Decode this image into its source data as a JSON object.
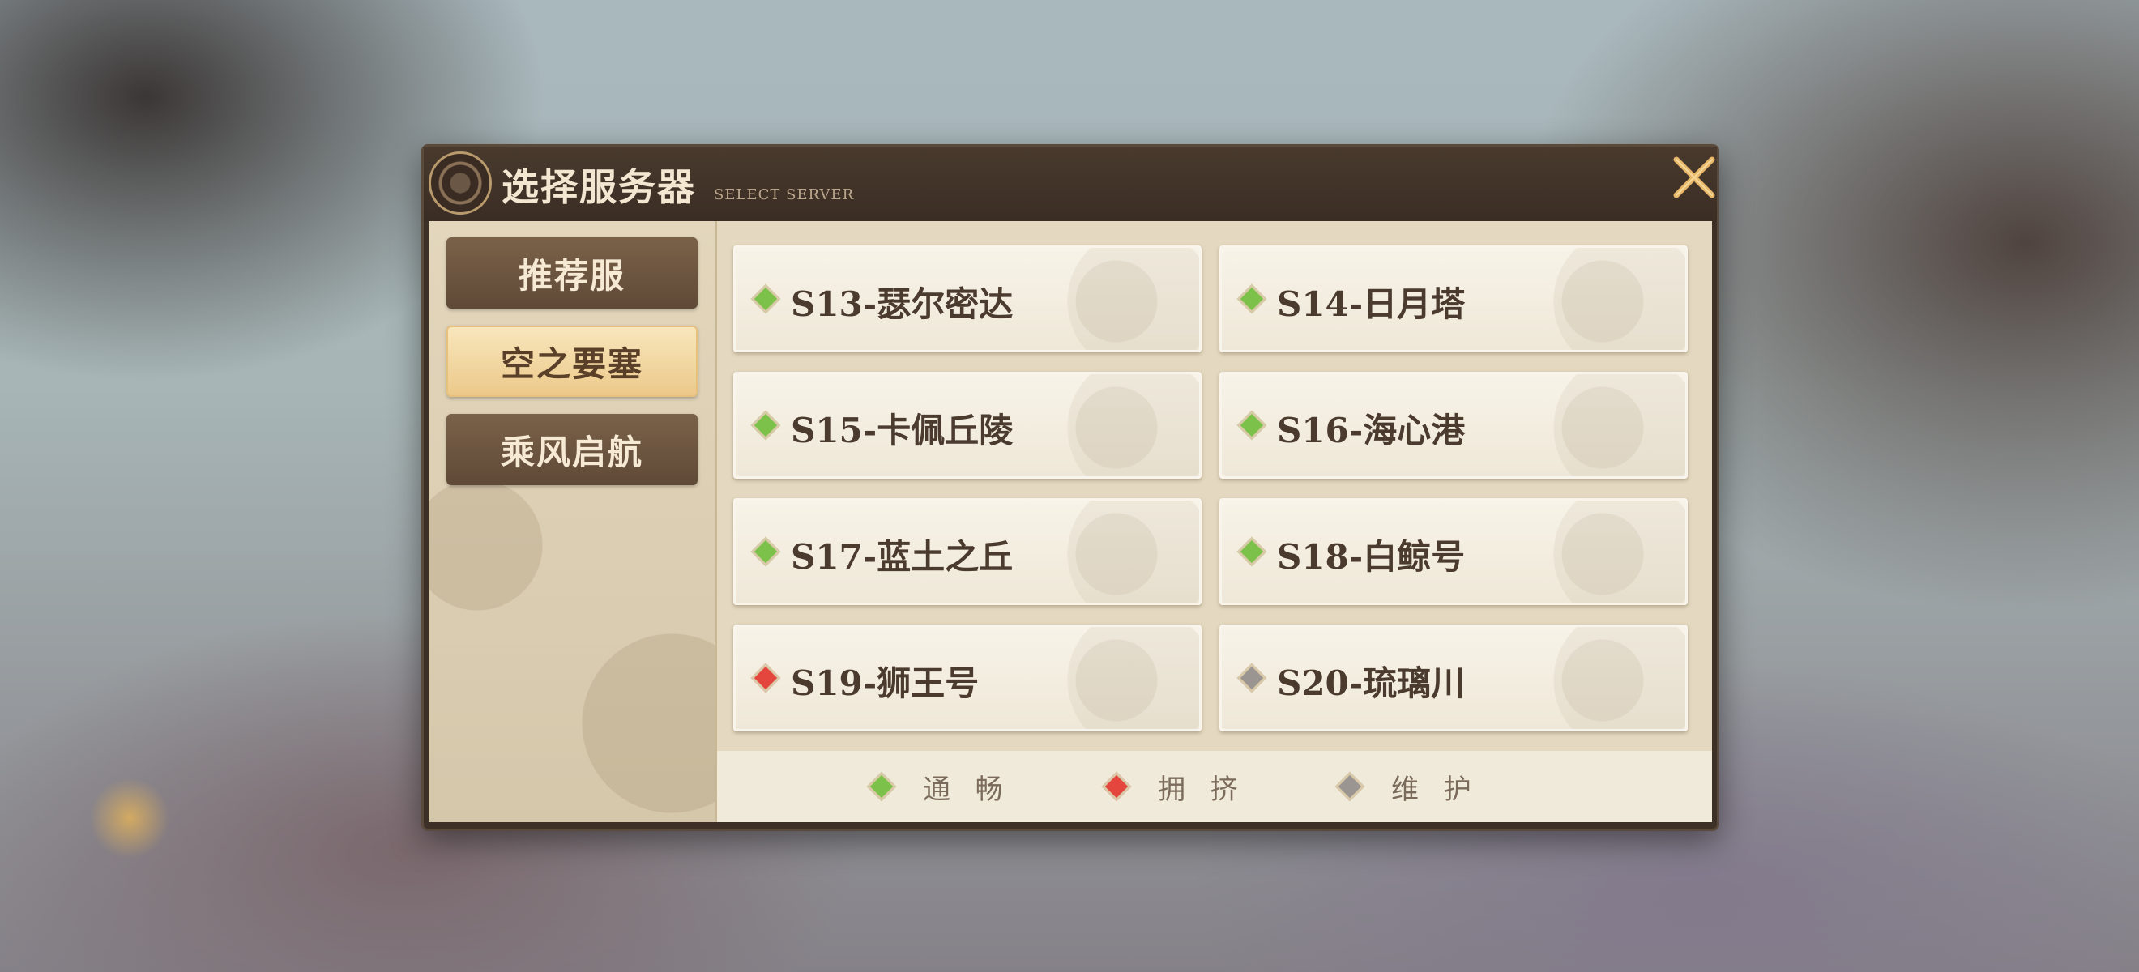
{
  "dialog": {
    "title": "选择服务器",
    "subtitle": "SELECT SERVER"
  },
  "tabs": [
    {
      "label": "推荐服",
      "active": false
    },
    {
      "label": "空之要塞",
      "active": true
    },
    {
      "label": "乘风启航",
      "active": false
    }
  ],
  "servers": [
    {
      "name": "S13-瑟尔密达",
      "status": "通畅"
    },
    {
      "name": "S14-日月塔",
      "status": "通畅"
    },
    {
      "name": "S15-卡佩丘陵",
      "status": "通畅"
    },
    {
      "name": "S16-海心港",
      "status": "通畅"
    },
    {
      "name": "S17-蓝土之丘",
      "status": "通畅"
    },
    {
      "name": "S18-白鲸号",
      "status": "通畅"
    },
    {
      "name": "S19-狮王号",
      "status": "拥挤"
    },
    {
      "name": "S20-琉璃川",
      "status": "维护"
    }
  ],
  "legend": [
    {
      "label": "通 畅",
      "color": "#7cc24a"
    },
    {
      "label": "拥 挤",
      "color": "#e4463e"
    },
    {
      "label": "维 护",
      "color": "#9a9590"
    }
  ],
  "status_colors": {
    "通畅": "#7cc24a",
    "拥挤": "#e4463e",
    "维护": "#9a9590"
  }
}
